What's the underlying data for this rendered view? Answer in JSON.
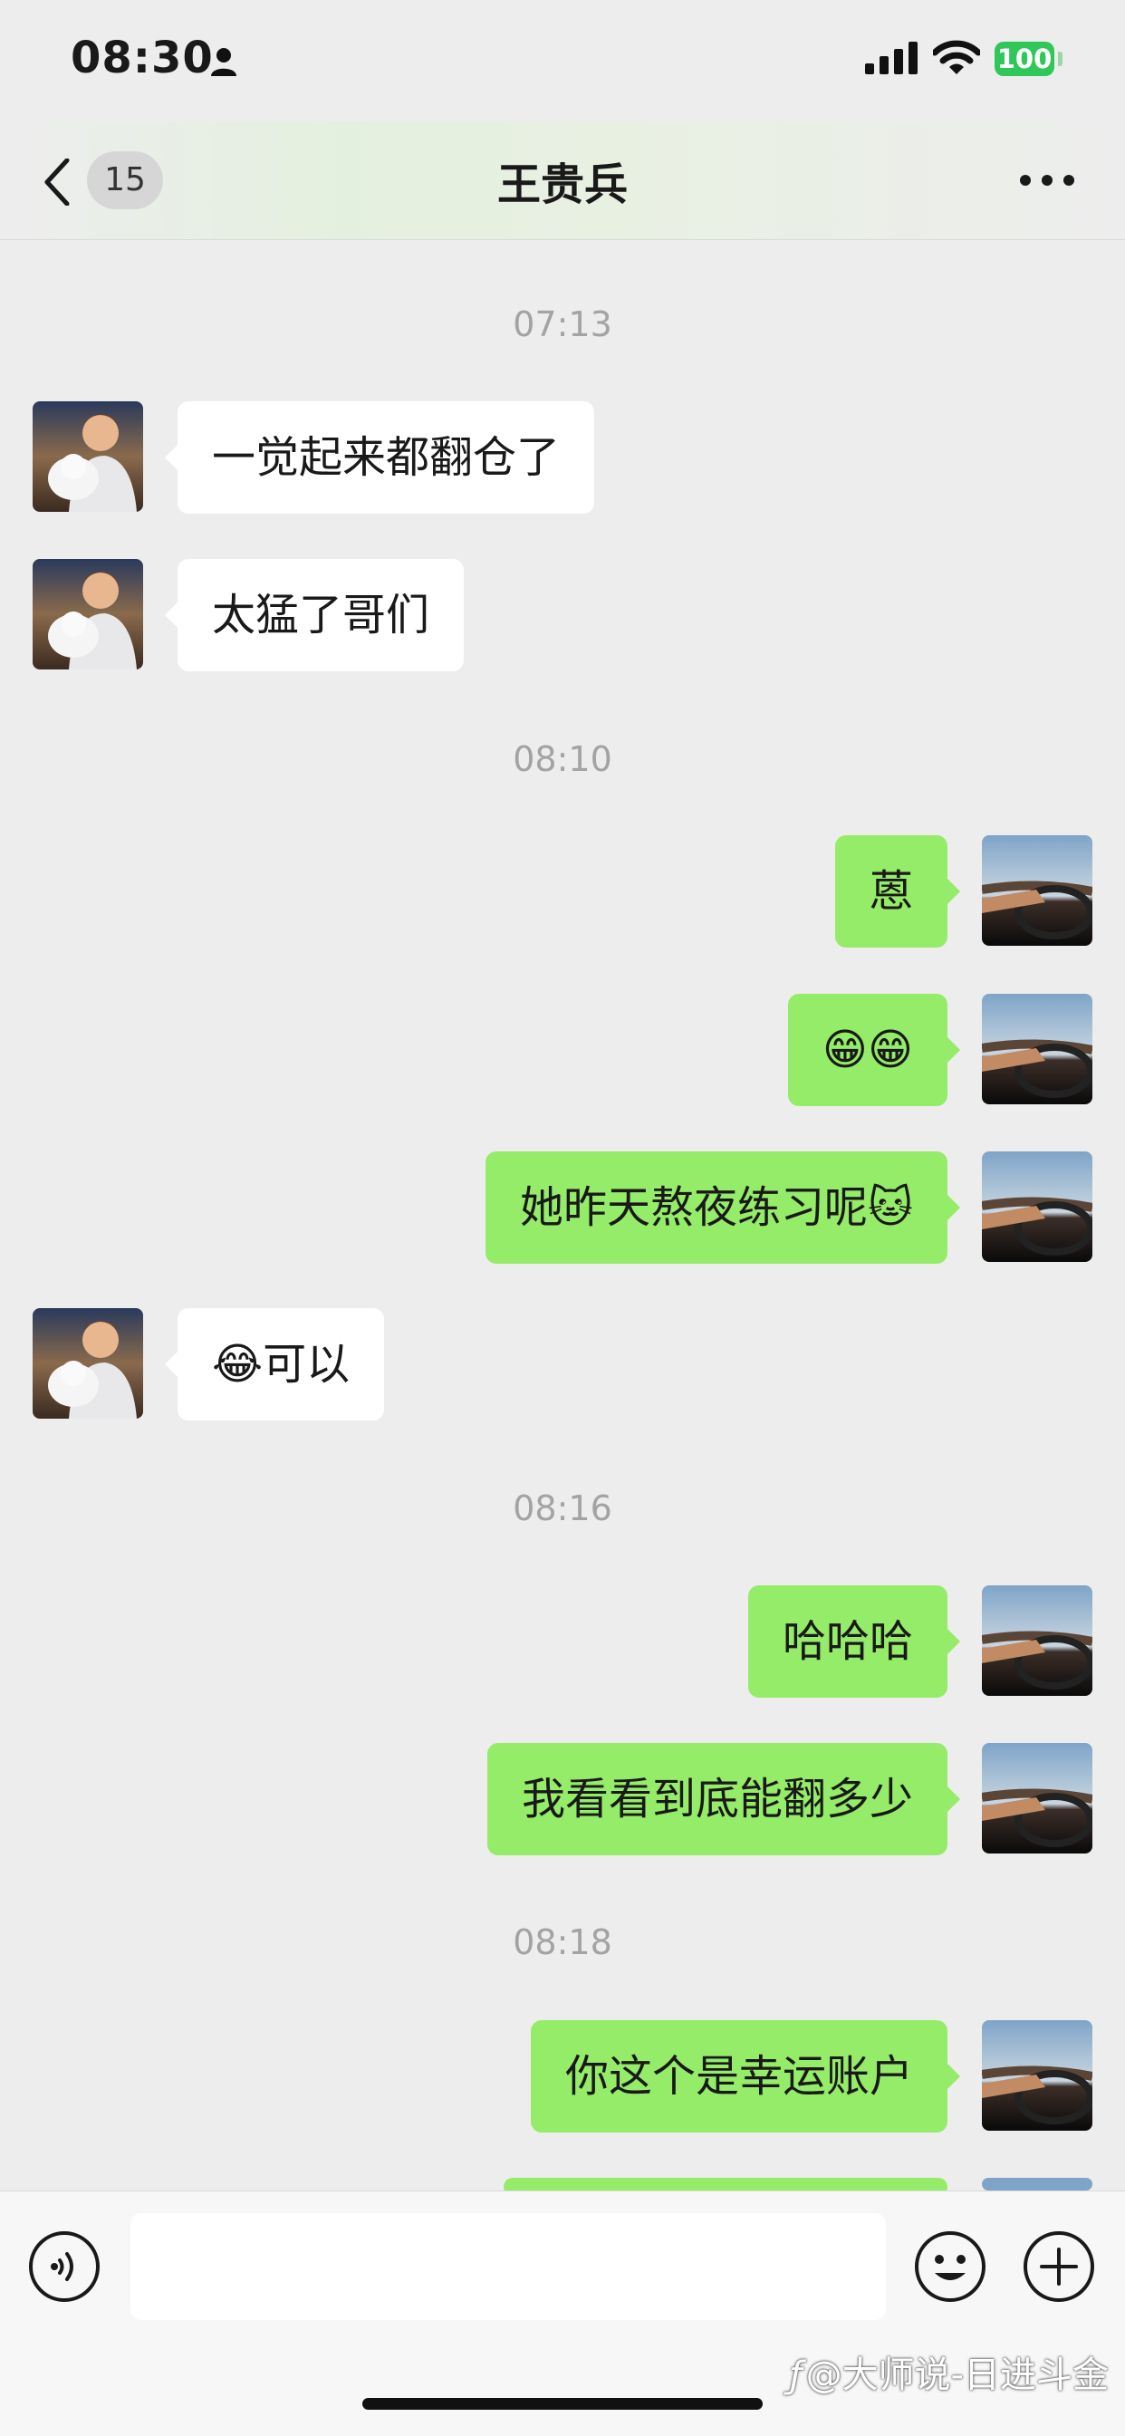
{
  "status_bar": {
    "time": "08:30",
    "battery": "100"
  },
  "nav": {
    "unread_count": "15",
    "title": "王贵兵"
  },
  "messages": [
    {
      "type": "time",
      "text": "07:13"
    },
    {
      "type": "in",
      "text": "一觉起来都翻仓了"
    },
    {
      "type": "in",
      "text": "太猛了哥们"
    },
    {
      "type": "time",
      "text": "08:10"
    },
    {
      "type": "out",
      "text": "蒽"
    },
    {
      "type": "out",
      "text": "😁😁"
    },
    {
      "type": "out",
      "text": "她昨天熬夜练习呢🐱"
    },
    {
      "type": "in",
      "text": "😂可以"
    },
    {
      "type": "time",
      "text": "08:16"
    },
    {
      "type": "out",
      "text": "哈哈哈"
    },
    {
      "type": "out",
      "text": "我看看到底能翻多少"
    },
    {
      "type": "time",
      "text": "08:18"
    },
    {
      "type": "out",
      "text": "你这个是幸运账户"
    }
  ],
  "input": {
    "placeholder": ""
  },
  "watermark": {
    "logo": "ƒ",
    "text": "@大师说-日进斗金"
  },
  "colors": {
    "background": "#ededed",
    "outgoing_bubble": "#95ec69",
    "incoming_bubble": "#ffffff",
    "battery": "#30c759"
  },
  "icons": [
    "person-icon",
    "signal-icon",
    "wifi-icon",
    "back-chevron-icon",
    "more-icon",
    "voice-icon",
    "emoji-icon",
    "plus-icon"
  ]
}
